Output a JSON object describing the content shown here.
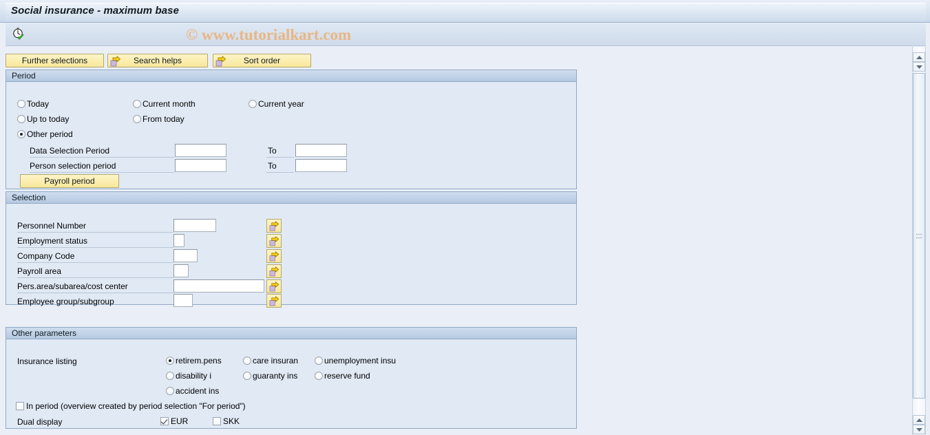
{
  "window": {
    "title": "Social insurance - maximum base"
  },
  "toolbar": {
    "execute_icon": "clock-check-icon",
    "watermark": "© www.tutorialkart.com"
  },
  "buttons": [
    {
      "label": "Further selections",
      "icon": null
    },
    {
      "label": "Search helps",
      "icon": "yellow-arrow-icon"
    },
    {
      "label": "Sort order",
      "icon": "yellow-arrow-icon"
    }
  ],
  "period": {
    "title": "Period",
    "radios": [
      {
        "label": "Today",
        "selected": false
      },
      {
        "label": "Current month",
        "selected": false
      },
      {
        "label": "Current year",
        "selected": false
      },
      {
        "label": "Up to today",
        "selected": false
      },
      {
        "label": "From today",
        "selected": false
      },
      {
        "label": "Other period",
        "selected": true
      }
    ],
    "fields": [
      {
        "label": "Data Selection Period",
        "value": "",
        "to_label": "To",
        "to_value": ""
      },
      {
        "label": "Person selection period",
        "value": "",
        "to_label": "To",
        "to_value": ""
      }
    ],
    "payroll_button": "Payroll period"
  },
  "selection": {
    "title": "Selection",
    "rows": [
      {
        "label": "Personnel Number",
        "value": ""
      },
      {
        "label": "Employment status",
        "value": ""
      },
      {
        "label": "Company Code",
        "value": ""
      },
      {
        "label": "Payroll area",
        "value": ""
      },
      {
        "label": "Pers.area/subarea/cost center",
        "value": ""
      },
      {
        "label": "Employee group/subgroup",
        "value": ""
      }
    ],
    "multi_select_icon": "yellow-arrow-icon"
  },
  "other_parameters": {
    "title": "Other parameters",
    "insurance_listing_label": "Insurance listing",
    "insurance_options": [
      {
        "label": "retirem.pens",
        "selected": true
      },
      {
        "label": "care insuran",
        "selected": false
      },
      {
        "label": "unemployment insu",
        "selected": false
      },
      {
        "label": "disability i",
        "selected": false
      },
      {
        "label": "guaranty ins",
        "selected": false
      },
      {
        "label": "reserve fund",
        "selected": false
      },
      {
        "label": "accident ins",
        "selected": false
      }
    ],
    "in_period": {
      "label": "In period (overview created by period selection \"For period\")",
      "checked": false
    },
    "dual_display_label": "Dual display",
    "dual_display": [
      {
        "label": "EUR",
        "checked": true
      },
      {
        "label": "SKK",
        "checked": false
      }
    ]
  },
  "scrollbar": {
    "up_icon": "triangle-up-icon",
    "down_icon": "triangle-down-icon"
  },
  "colors": {
    "accent": "#f7e79b",
    "titlebar": "#cfdcec",
    "group_bg": "#e0e9f4",
    "watermark": "#e8b784"
  }
}
